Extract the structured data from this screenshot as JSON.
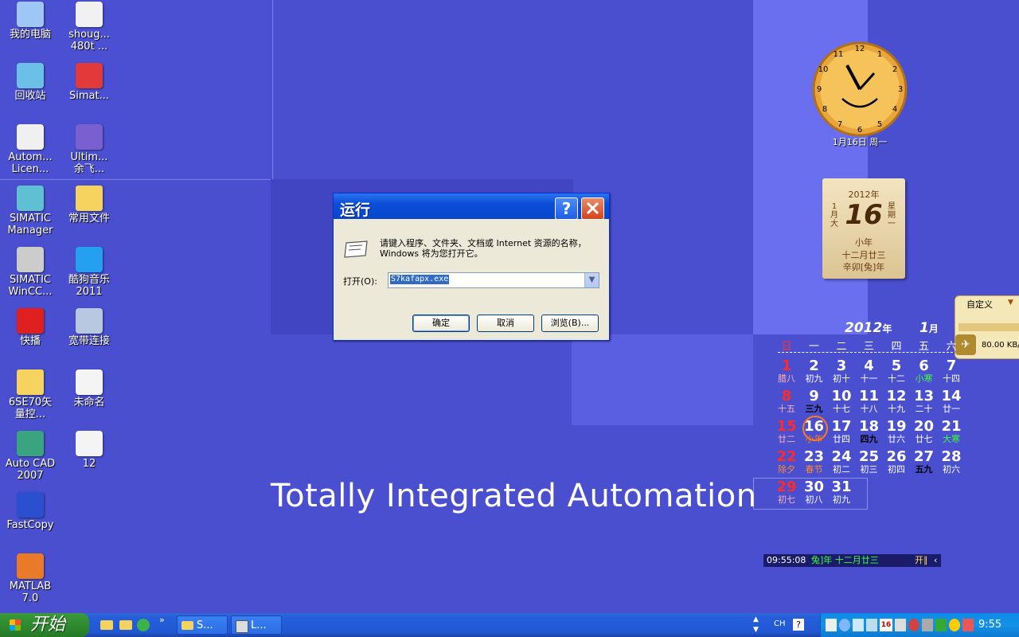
{
  "desktop_icons": [
    {
      "label": "我的电脑",
      "icon": "my-computer-icon"
    },
    {
      "label": "shoug...\n480t ...",
      "icon": "pdf-file-icon"
    },
    {
      "label": "回收站",
      "icon": "recycle-bin-icon"
    },
    {
      "label": "Simat...",
      "icon": "simatic-icon"
    },
    {
      "label": "Autom...\nLicen...",
      "icon": "license-tool-icon"
    },
    {
      "label": "Ultim...\n余飞...",
      "icon": "globe-icon"
    },
    {
      "label": "SIMATIC\nManager",
      "icon": "simatic-manager-icon"
    },
    {
      "label": "常用文件",
      "icon": "folder-icon"
    },
    {
      "label": "SIMATIC\nWinCC...",
      "icon": "wincc-icon"
    },
    {
      "label": "酷狗音乐\n2011",
      "icon": "kugou-icon"
    },
    {
      "label": "快播",
      "icon": "qvod-icon"
    },
    {
      "label": "宽带连接",
      "icon": "network-connection-icon"
    },
    {
      "label": "6SE70矢\n量控...",
      "icon": "folder-icon"
    },
    {
      "label": "未命名",
      "icon": "image-file-icon"
    },
    {
      "label": "Auto CAD\n2007",
      "icon": "autocad-icon"
    },
    {
      "label": "12",
      "icon": "image-file-icon"
    },
    {
      "label": "FastCopy",
      "icon": "fastcopy-icon"
    },
    {
      "label": "MATLAB\n7.0",
      "icon": "matlab-icon"
    }
  ],
  "wallpaper_text": "Totally Integrated Automation",
  "run_dialog": {
    "title": "运行",
    "help_symbol": "?",
    "description": "请键入程序、文件夹、文档或 Internet 资源的名称，Windows 将为您打开它。",
    "open_label": "打开(O):",
    "open_value": "S7kafapx.exe",
    "ok": "确定",
    "cancel": "取消",
    "browse": "浏览(B)..."
  },
  "clock_widget": {
    "caption": "1月16日 周一"
  },
  "almanac": {
    "year": "2012年",
    "month": "1\n月\n大",
    "day": "16",
    "weekday": "星\n期\n一",
    "term": "小年",
    "lunar": "十二月廿三",
    "ganzhi": "辛卯[兔]年"
  },
  "net_widget": {
    "mode": "自定义",
    "speed": "80.00 KB/"
  },
  "calendar": {
    "year": "2012",
    "year_suffix": "年",
    "month": "1",
    "month_suffix": "月",
    "weekdays": [
      "日",
      "一",
      "二",
      "三",
      "四",
      "五",
      "六"
    ],
    "rows": [
      [
        {
          "n": "1",
          "l": "腊八"
        },
        {
          "n": "2",
          "l": "初九"
        },
        {
          "n": "3",
          "l": "初十"
        },
        {
          "n": "4",
          "l": "十一"
        },
        {
          "n": "5",
          "l": "十二"
        },
        {
          "n": "6",
          "l": "小寒"
        },
        {
          "n": "7",
          "l": "十四"
        }
      ],
      [
        {
          "n": "8",
          "l": "十五"
        },
        {
          "n": "9",
          "l": "三九"
        },
        {
          "n": "10",
          "l": "十七"
        },
        {
          "n": "11",
          "l": "十八"
        },
        {
          "n": "12",
          "l": "十九"
        },
        {
          "n": "13",
          "l": "二十"
        },
        {
          "n": "14",
          "l": "廿一"
        }
      ],
      [
        {
          "n": "15",
          "l": "廿二"
        },
        {
          "n": "16",
          "l": "小年"
        },
        {
          "n": "17",
          "l": "廿四"
        },
        {
          "n": "18",
          "l": "四九"
        },
        {
          "n": "19",
          "l": "廿六"
        },
        {
          "n": "20",
          "l": "廿七"
        },
        {
          "n": "21",
          "l": "大寒"
        }
      ],
      [
        {
          "n": "22",
          "l": "除夕"
        },
        {
          "n": "23",
          "l": "春节"
        },
        {
          "n": "24",
          "l": "初二"
        },
        {
          "n": "25",
          "l": "初三"
        },
        {
          "n": "26",
          "l": "初四"
        },
        {
          "n": "27",
          "l": "五九"
        },
        {
          "n": "28",
          "l": "初六"
        }
      ],
      [
        {
          "n": "29",
          "l": "初七"
        },
        {
          "n": "30",
          "l": "初八"
        },
        {
          "n": "31",
          "l": "初九"
        }
      ]
    ],
    "status_time": "09:55:08",
    "status_lunar": "兔]年 十二月廿三",
    "status_btn": "开∥"
  },
  "taskbar": {
    "start": "开始",
    "tasks": [
      "S...",
      "L..."
    ],
    "ime": "CH",
    "clock": "9:55"
  }
}
